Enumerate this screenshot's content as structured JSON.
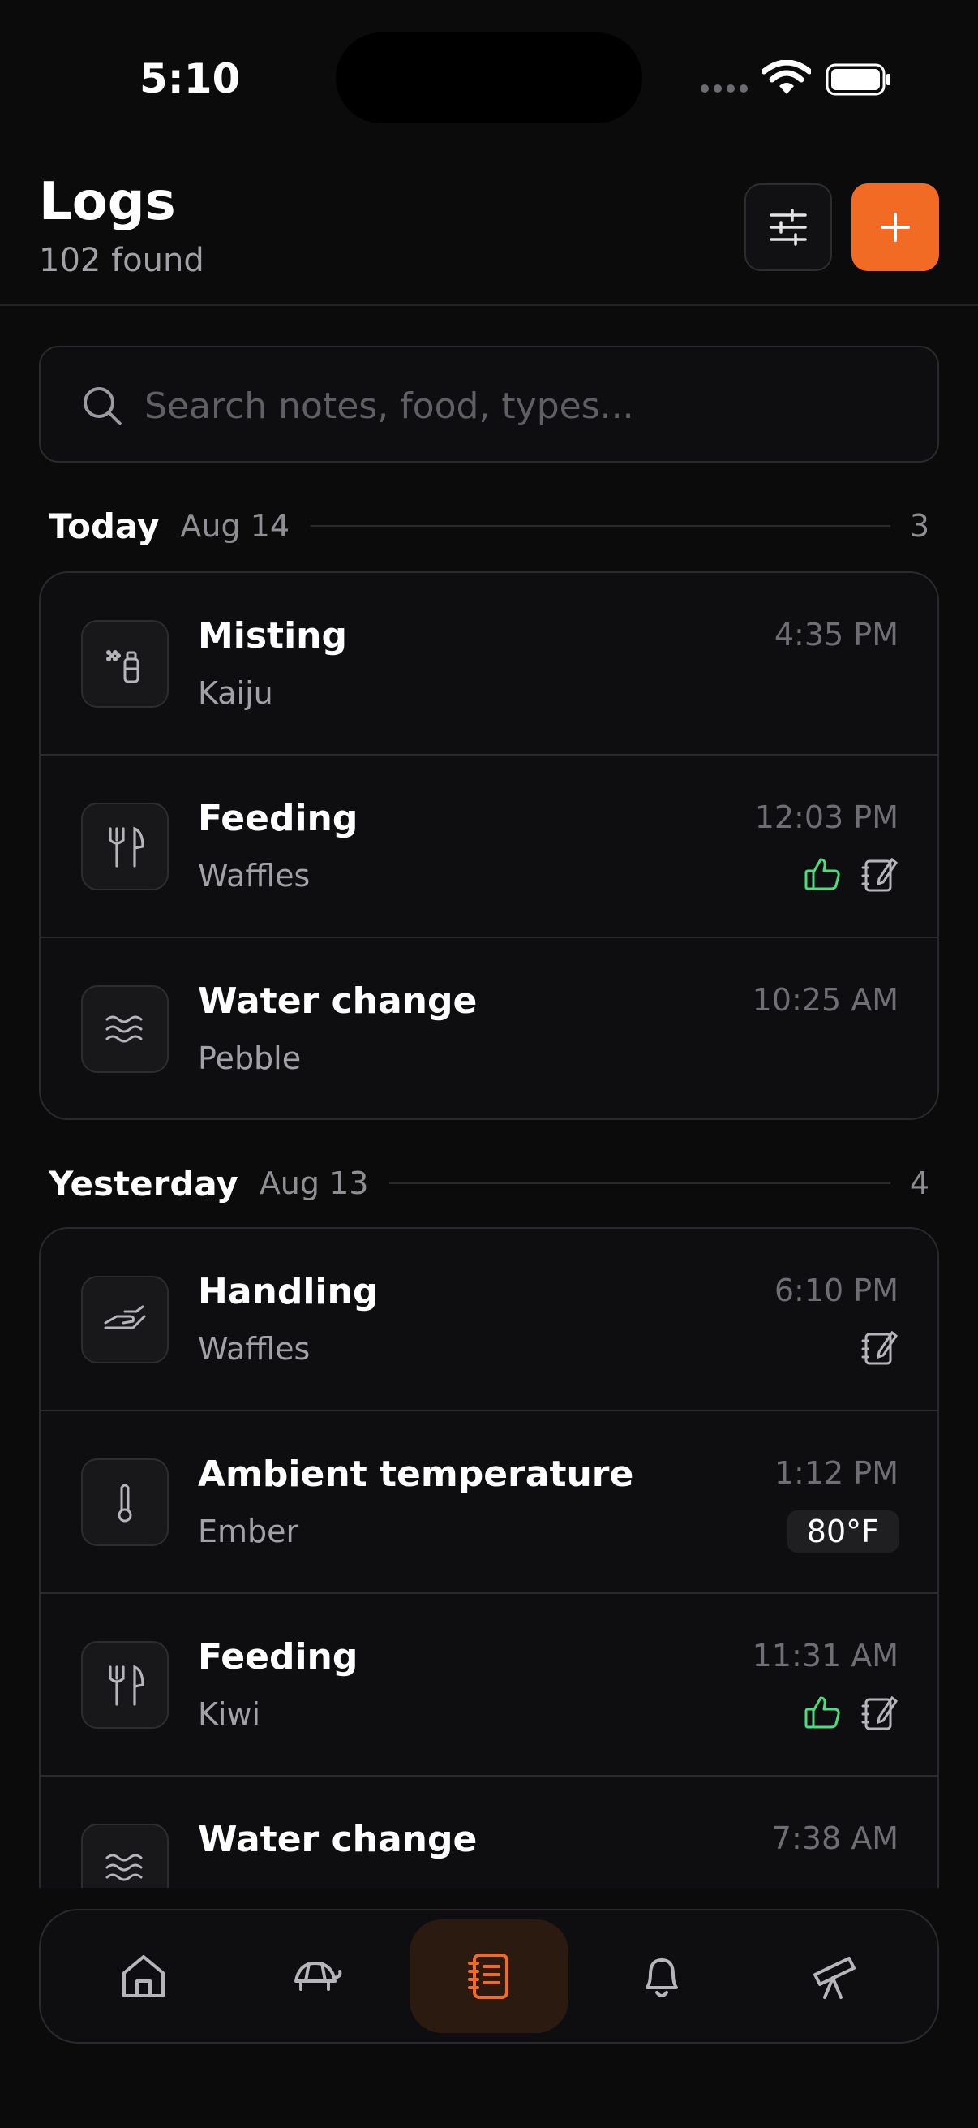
{
  "status": {
    "time": "5:10"
  },
  "header": {
    "title": "Logs",
    "subtitle": "102 found"
  },
  "search": {
    "placeholder": "Search notes, food, types..."
  },
  "sections": [
    {
      "day": "Today",
      "date": "Aug 14",
      "count": "3",
      "rows": [
        {
          "name": "Misting",
          "pet": "Kaiju",
          "time": "4:35 PM",
          "icon": "spray-bottle-icon"
        },
        {
          "name": "Feeding",
          "pet": "Waffles",
          "time": "12:03 PM",
          "icon": "utensils-icon",
          "badges": [
            "thumbs-up-icon",
            "note-icon"
          ]
        },
        {
          "name": "Water change",
          "pet": "Pebble",
          "time": "10:25 AM",
          "icon": "water-waves-icon"
        }
      ]
    },
    {
      "day": "Yesterday",
      "date": "Aug 13",
      "count": "4",
      "rows": [
        {
          "name": "Handling",
          "pet": "Waffles",
          "time": "6:10 PM",
          "icon": "hand-icon",
          "badges": [
            "note-icon"
          ]
        },
        {
          "name": "Ambient temperature",
          "pet": "Ember",
          "time": "1:12 PM",
          "icon": "thermometer-icon",
          "tag": "80°F"
        },
        {
          "name": "Feeding",
          "pet": "Kiwi",
          "time": "11:31 AM",
          "icon": "utensils-icon",
          "badges": [
            "thumbs-up-icon",
            "note-icon"
          ]
        },
        {
          "name": "Water change",
          "pet": "",
          "time": "7:38 AM",
          "icon": "water-waves-icon"
        }
      ]
    }
  ],
  "nav": {
    "tabs": [
      {
        "icon": "home-icon",
        "active": false
      },
      {
        "icon": "turtle-icon",
        "active": false
      },
      {
        "icon": "logbook-icon",
        "active": true
      },
      {
        "icon": "bell-icon",
        "active": false
      },
      {
        "icon": "telescope-icon",
        "active": false
      }
    ]
  },
  "colors": {
    "accent": "#f26b24",
    "positive": "#4ade80",
    "background": "#0b0b0c"
  }
}
